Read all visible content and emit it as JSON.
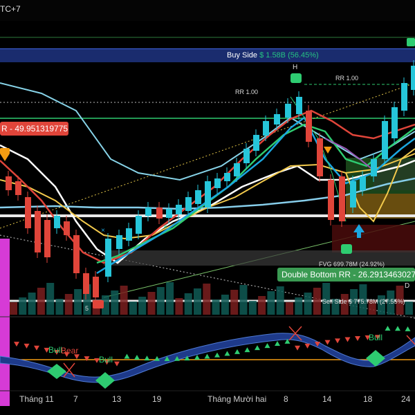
{
  "timezone_label": "TC+7",
  "buy_side": {
    "prefix": "Buy Side",
    "amount": "$ 1.58B (56.45%)"
  },
  "rr_left": "RR 1.00",
  "rr_right": "RR 1.00",
  "h_label": "H",
  "rr_box": "R - 49.951319775",
  "double_bottom": "Double Bottom RR - 26.2913463027",
  "fvg_label": "FVG 699.78M (24.92%)",
  "sell_side": "Sell Side $ 775.78M (27.55%)",
  "d_mark": "D",
  "ll_label": "5",
  "oscillator_labels": {
    "bull1": "Bull",
    "bear1": "Bear",
    "bull2": "Bull",
    "bull3": "Bull"
  },
  "x_axis_labels": [
    {
      "text": "Tháng 11"
    },
    {
      "text": "7"
    },
    {
      "text": "13"
    },
    {
      "text": "19"
    },
    {
      "text": "Tháng Mười hai"
    },
    {
      "text": "8"
    },
    {
      "text": "14"
    },
    {
      "text": "18"
    },
    {
      "text": "24"
    }
  ],
  "colors": {
    "up": "#26c6da",
    "down": "#e0453a",
    "buy_box": "#3e63dd",
    "bull": "#2ecc71",
    "bear": "#e0453a"
  }
}
